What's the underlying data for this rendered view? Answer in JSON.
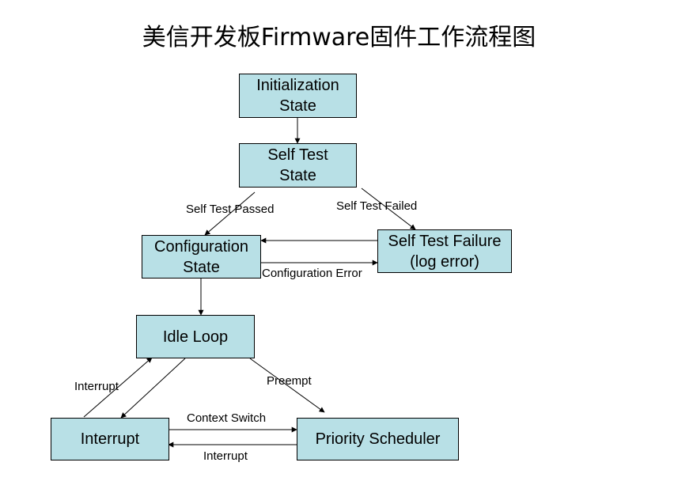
{
  "title": "美信开发板Firmware固件工作流程图",
  "colors": {
    "node_fill": "#b8e0e6",
    "stroke": "#000000"
  },
  "nodes": {
    "init": {
      "line1": "Initialization",
      "line2": "State"
    },
    "selftest": {
      "line1": "Self Test",
      "line2": "State"
    },
    "config": {
      "line1": "Configuration",
      "line2": "State"
    },
    "failure": {
      "line1": "Self Test Failure",
      "line2": "(log error)"
    },
    "idle": {
      "line1": "Idle Loop"
    },
    "interrupt": {
      "line1": "Interrupt"
    },
    "scheduler": {
      "line1": "Priority Scheduler"
    }
  },
  "edges": {
    "selftest_passed": "Self Test Passed",
    "selftest_failed": "Self Test Failed",
    "config_error": "Configuration Error",
    "interrupt_up": "Interrupt",
    "preempt": "Preempt",
    "context_switch": "Context Switch",
    "interrupt_back": "Interrupt"
  }
}
